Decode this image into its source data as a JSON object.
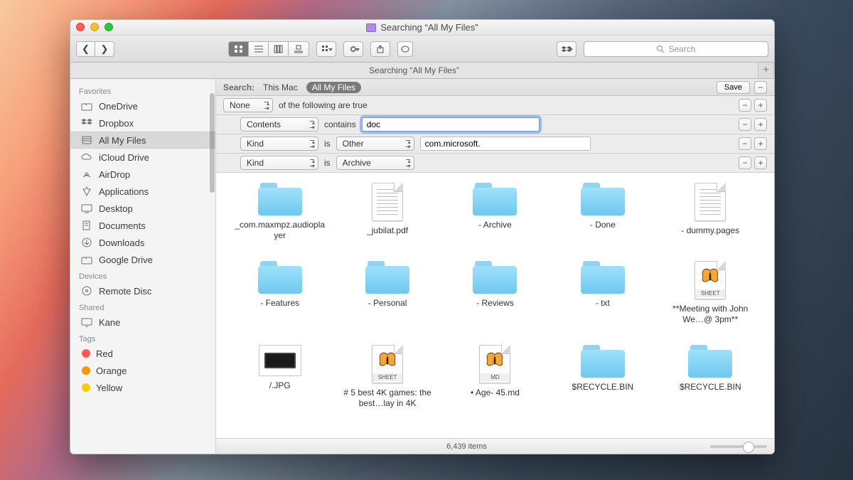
{
  "window": {
    "title": "Searching “All My Files”",
    "tab": "Searching “All My Files”"
  },
  "toolbar": {
    "search_placeholder": "Search"
  },
  "sidebar": {
    "favorites_header": "Favorites",
    "devices_header": "Devices",
    "shared_header": "Shared",
    "tags_header": "Tags",
    "favorites": [
      {
        "label": "OneDrive",
        "icon": "folder"
      },
      {
        "label": "Dropbox",
        "icon": "dropbox"
      },
      {
        "label": "All My Files",
        "icon": "all-files",
        "active": true
      },
      {
        "label": "iCloud Drive",
        "icon": "cloud"
      },
      {
        "label": "AirDrop",
        "icon": "airdrop"
      },
      {
        "label": "Applications",
        "icon": "apps"
      },
      {
        "label": "Desktop",
        "icon": "desktop"
      },
      {
        "label": "Documents",
        "icon": "documents"
      },
      {
        "label": "Downloads",
        "icon": "downloads"
      },
      {
        "label": "Google Drive",
        "icon": "folder"
      }
    ],
    "devices": [
      {
        "label": "Remote Disc",
        "icon": "disc"
      }
    ],
    "shared": [
      {
        "label": "Kane",
        "icon": "display"
      }
    ],
    "tags": [
      {
        "label": "Red",
        "color": "#ff5a52"
      },
      {
        "label": "Orange",
        "color": "#ff9500"
      },
      {
        "label": "Yellow",
        "color": "#ffcc00"
      }
    ]
  },
  "scope": {
    "label": "Search:",
    "this_mac": "This Mac",
    "all_my_files": "All My Files",
    "save": "Save"
  },
  "criteria": {
    "row0_attr": "None",
    "row0_text": "of the following are true",
    "row1_attr": "Contents",
    "row1_op": "contains",
    "row1_value": "doc",
    "row2_attr": "Kind",
    "row2_op": "is",
    "row2_value": "Other",
    "row2_text": "com.microsoft.",
    "row3_attr": "Kind",
    "row3_op": "is",
    "row3_value": "Archive"
  },
  "results": [
    {
      "type": "folder",
      "label": "_com.maxmpz.audioplayer"
    },
    {
      "type": "pdf",
      "label": "_jubilat.pdf"
    },
    {
      "type": "folder",
      "label": "- Archive"
    },
    {
      "type": "folder",
      "label": "- Done"
    },
    {
      "type": "pages",
      "label": "- dummy.pages"
    },
    {
      "type": "folder",
      "label": "- Features"
    },
    {
      "type": "folder",
      "label": "- Personal"
    },
    {
      "type": "folder",
      "label": "- Reviews"
    },
    {
      "type": "folder",
      "label": "- txt"
    },
    {
      "type": "sheet",
      "label": "**Meeting with John We…@ 3pm**"
    },
    {
      "type": "jpg",
      "label": "/.JPG"
    },
    {
      "type": "sheet",
      "label": "# 5 best 4K games: the best…lay in 4K"
    },
    {
      "type": "md",
      "label": "• Age- 45.md"
    },
    {
      "type": "folder",
      "label": "$RECYCLE.BIN"
    },
    {
      "type": "folder",
      "label": "$RECYCLE.BIN"
    }
  ],
  "status": {
    "count": "6,439 items"
  }
}
